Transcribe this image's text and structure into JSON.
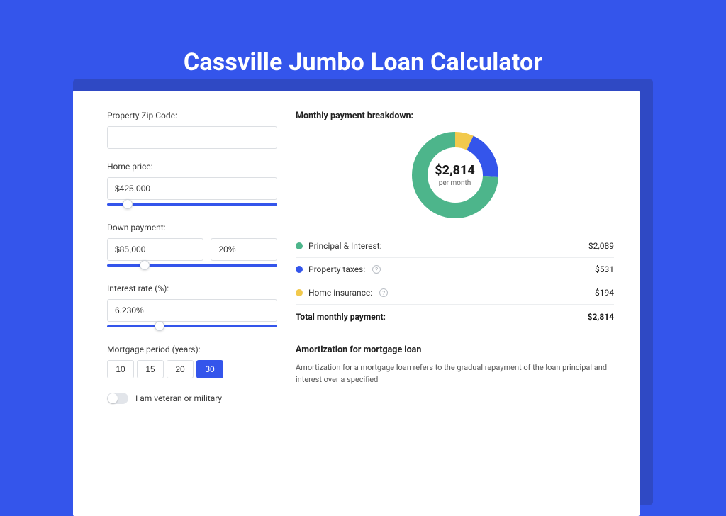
{
  "hero": {
    "title": "Cassville Jumbo Loan Calculator"
  },
  "form": {
    "zip_label": "Property Zip Code:",
    "zip_value": "",
    "price_label": "Home price:",
    "price_value": "$425,000",
    "down_label": "Down payment:",
    "down_value": "$85,000",
    "down_pct": "20%",
    "rate_label": "Interest rate (%):",
    "rate_value": "6.230%",
    "period_label": "Mortgage period (years):",
    "periods": [
      "10",
      "15",
      "20",
      "30"
    ],
    "period_active_index": 3,
    "veteran_label": "I am veteran or military",
    "sliders": {
      "price_pos": 9,
      "down_pos": 19,
      "rate_pos": 28
    }
  },
  "breakdown": {
    "title": "Monthly payment breakdown:",
    "center_amount": "$2,814",
    "center_sub": "per month",
    "items": [
      {
        "label": "Principal & Interest:",
        "value": "$2,089",
        "color": "#4db58b",
        "info": false
      },
      {
        "label": "Property taxes:",
        "value": "$531",
        "color": "#3455eb",
        "info": true
      },
      {
        "label": "Home insurance:",
        "value": "$194",
        "color": "#f2c94c",
        "info": true
      }
    ],
    "total_label": "Total monthly payment:",
    "total_value": "$2,814"
  },
  "chart_data": {
    "type": "pie",
    "title": "Monthly payment breakdown",
    "series": [
      {
        "name": "Principal & Interest",
        "value": 2089,
        "color": "#4db58b"
      },
      {
        "name": "Property taxes",
        "value": 531,
        "color": "#3455eb"
      },
      {
        "name": "Home insurance",
        "value": 194,
        "color": "#f2c94c"
      }
    ],
    "total": 2814,
    "donut_inner_ratio": 0.62
  },
  "amort": {
    "title": "Amortization for mortgage loan",
    "text": "Amortization for a mortgage loan refers to the gradual repayment of the loan principal and interest over a specified"
  }
}
